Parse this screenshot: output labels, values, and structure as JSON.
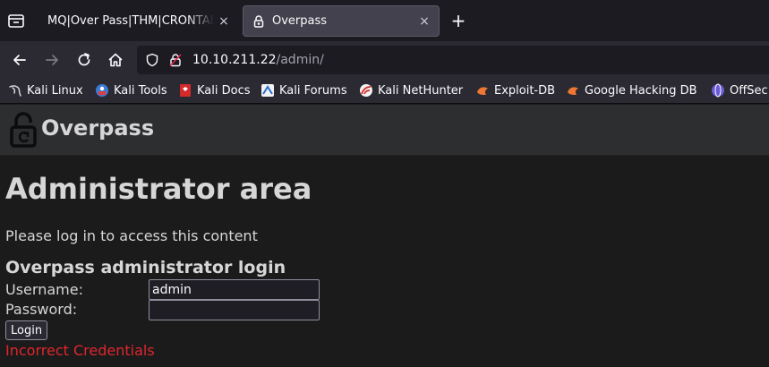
{
  "tabs": [
    {
      "title": "MQ|Over Pass|THM|CRONTAB",
      "active": false,
      "close": "×"
    },
    {
      "title": "Overpass",
      "active": true,
      "close": "×"
    }
  ],
  "new_tab_label": "+",
  "url": {
    "host": "10.10.211.22",
    "path": "/admin/"
  },
  "bookmarks": [
    {
      "label": "Kali Linux",
      "icon": "kali-dragon-icon"
    },
    {
      "label": "Kali Tools",
      "icon": "kali-tools-icon"
    },
    {
      "label": "Kali Docs",
      "icon": "kali-docs-icon"
    },
    {
      "label": "Kali Forums",
      "icon": "kali-forums-icon"
    },
    {
      "label": "Kali NetHunter",
      "icon": "nethunter-icon"
    },
    {
      "label": "Exploit-DB",
      "icon": "exploit-db-icon"
    },
    {
      "label": "Google Hacking DB",
      "icon": "ghdb-icon"
    },
    {
      "label": "OffSec",
      "icon": "offsec-icon"
    }
  ],
  "site": {
    "name": "Overpass",
    "logo_icon": "padlock-logo-icon"
  },
  "page": {
    "heading": "Administrator area",
    "intro": "Please log in to access this content",
    "login_heading": "Overpass administrator login",
    "username_label": "Username:",
    "username_value": "admin",
    "password_label": "Password:",
    "password_value": "",
    "login_button": "Login",
    "error": "Incorrect Credentials"
  },
  "colors": {
    "error": "#e0262c",
    "header_bg": "#2d2e30",
    "page_bg": "#1b1b1b"
  }
}
